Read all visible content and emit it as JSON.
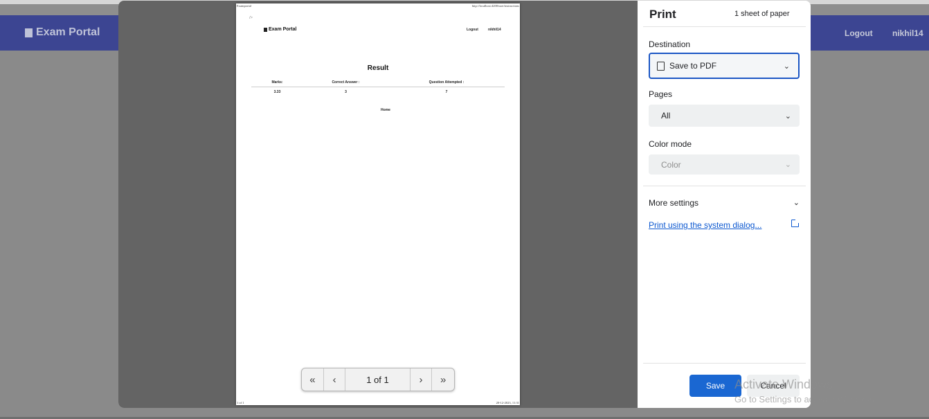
{
  "app": {
    "brand": "Exam Portal",
    "logout": "Logout",
    "username": "nikhil14",
    "nav_color": "#3c4592"
  },
  "preview": {
    "header_left": "Examportal",
    "header_right": "http://localhost:4200/user/instructions",
    "stray_text": "/>",
    "brand": "Exam Portal",
    "logout": "Logout",
    "username": "nikhil14",
    "title": "Result",
    "table": {
      "headers": [
        "Marks:",
        "Correct Answer :",
        "Question Attempted :"
      ],
      "values": [
        "3.33",
        "3",
        "7"
      ]
    },
    "home_link": "Home",
    "footer_left": "1 of 1",
    "footer_right": "20-12-2023, 11:31"
  },
  "pager": {
    "first_icon": "first-page-icon",
    "prev_icon": "prev-page-icon",
    "page_indicator": "1 of 1",
    "next_icon": "next-page-icon",
    "last_icon": "last-page-icon"
  },
  "settings": {
    "title": "Print",
    "sheets": "1 sheet of paper",
    "destination_label": "Destination",
    "destination_value": "Save to PDF",
    "pages_label": "Pages",
    "pages_value": "All",
    "color_mode_label": "Color mode",
    "color_mode_value": "Color",
    "more_settings": "More settings",
    "system_dialog_link": "Print using the system dialog...",
    "save_button": "Save",
    "cancel_button": "Cancel",
    "accent_color": "#1a67d2"
  },
  "watermark": {
    "line1": "Activate Windows",
    "line2": "Go to Settings to activate Windows."
  }
}
